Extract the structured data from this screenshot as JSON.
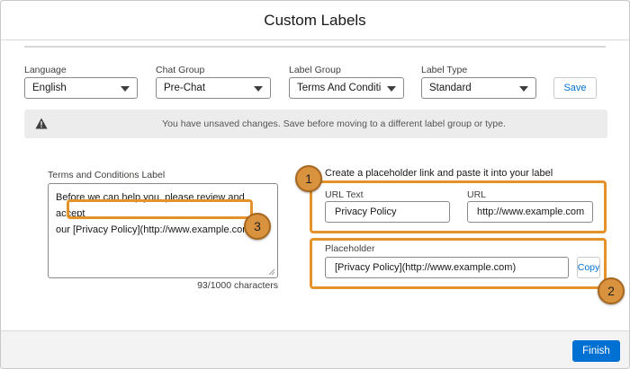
{
  "modal": {
    "title": "Custom Labels"
  },
  "filters": {
    "language": {
      "label": "Language",
      "value": "English"
    },
    "chat_group": {
      "label": "Chat Group",
      "value": "Pre-Chat"
    },
    "label_group": {
      "label": "Label Group",
      "value": "Terms And Conditi..."
    },
    "label_type": {
      "label": "Label Type",
      "value": "Standard"
    },
    "save_label": "Save"
  },
  "alert": {
    "icon": "warning-icon",
    "text": "You have unsaved changes. Save before moving to a different label group or type."
  },
  "terms": {
    "label": "Terms and Conditions Label",
    "text_line1": "Before we can help you, please review and accept",
    "text_line2_prefix": "our ",
    "text_line2_link": "[Privacy Policy](http://www.example.com)",
    "char_count": "93/1000 characters"
  },
  "placeholder_builder": {
    "heading": "Create a placeholder link and paste it into your label",
    "url_text_label": "URL Text",
    "url_text_value": "Privacy Policy",
    "url_label": "URL",
    "url_value": "http://www.example.com",
    "placeholder_label": "Placeholder",
    "placeholder_value": "[Privacy Policy](http://www.example.com)",
    "copy_label": "Copy"
  },
  "callouts": [
    "1",
    "2",
    "3"
  ],
  "footer": {
    "finish_label": "Finish"
  },
  "colors": {
    "brand": "#0070d2",
    "highlight": "#e4932a",
    "callout": "#d9923d"
  }
}
